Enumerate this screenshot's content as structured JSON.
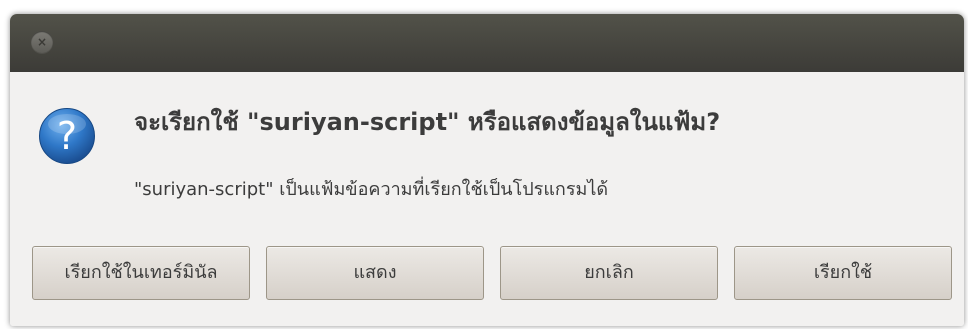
{
  "dialog": {
    "close_glyph": "×",
    "title": "จะเรียกใช้ \"suriyan-script\" หรือแสดงข้อมูลในแฟ้ม?",
    "description": "\"suriyan-script\" เป็นแฟ้มข้อความที่เรียกใช้เป็นโปรแกรมได้",
    "icon": "question-icon",
    "buttons": {
      "run_in_terminal": "เรียกใช้ในเทอร์มินัล",
      "display": "แสดง",
      "cancel": "ยกเลิก",
      "run": "เรียกใช้"
    }
  },
  "colors": {
    "titlebar": "#3c3b37",
    "dialog_bg": "#f2f1f0",
    "icon_blue": "#2a73c4",
    "text": "#3c3c3c"
  }
}
